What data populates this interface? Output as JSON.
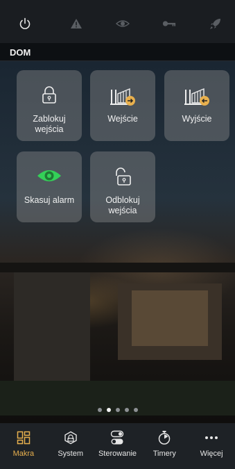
{
  "colors": {
    "accent": "#e8b04e",
    "active_green": "#34d058",
    "tile_bg": "#8c8c8c"
  },
  "topbar": {
    "icons": [
      "power-icon",
      "warning-icon",
      "eye-icon",
      "key-icon",
      "rocket-icon"
    ]
  },
  "header": {
    "title": "DOM"
  },
  "tiles": [
    {
      "label": "Zablokuj wejścia",
      "icon": "lock-closed-icon"
    },
    {
      "label": "Wejście",
      "icon": "gate-enter-icon"
    },
    {
      "label": "Wyjście",
      "icon": "gate-exit-icon"
    },
    {
      "label": "Skasuj alarm",
      "icon": "eye-icon"
    },
    {
      "label": "Odblokuj wejścia",
      "icon": "lock-open-icon"
    }
  ],
  "pager": {
    "pages": 5,
    "active_index": 1
  },
  "nav": {
    "items": [
      {
        "label": "Makra",
        "icon": "macros-icon",
        "active": true
      },
      {
        "label": "System",
        "icon": "system-icon",
        "active": false
      },
      {
        "label": "Sterowanie",
        "icon": "toggle-icon",
        "active": false
      },
      {
        "label": "Timery",
        "icon": "timer-icon",
        "active": false
      },
      {
        "label": "Więcej",
        "icon": "more-icon",
        "active": false
      }
    ]
  }
}
